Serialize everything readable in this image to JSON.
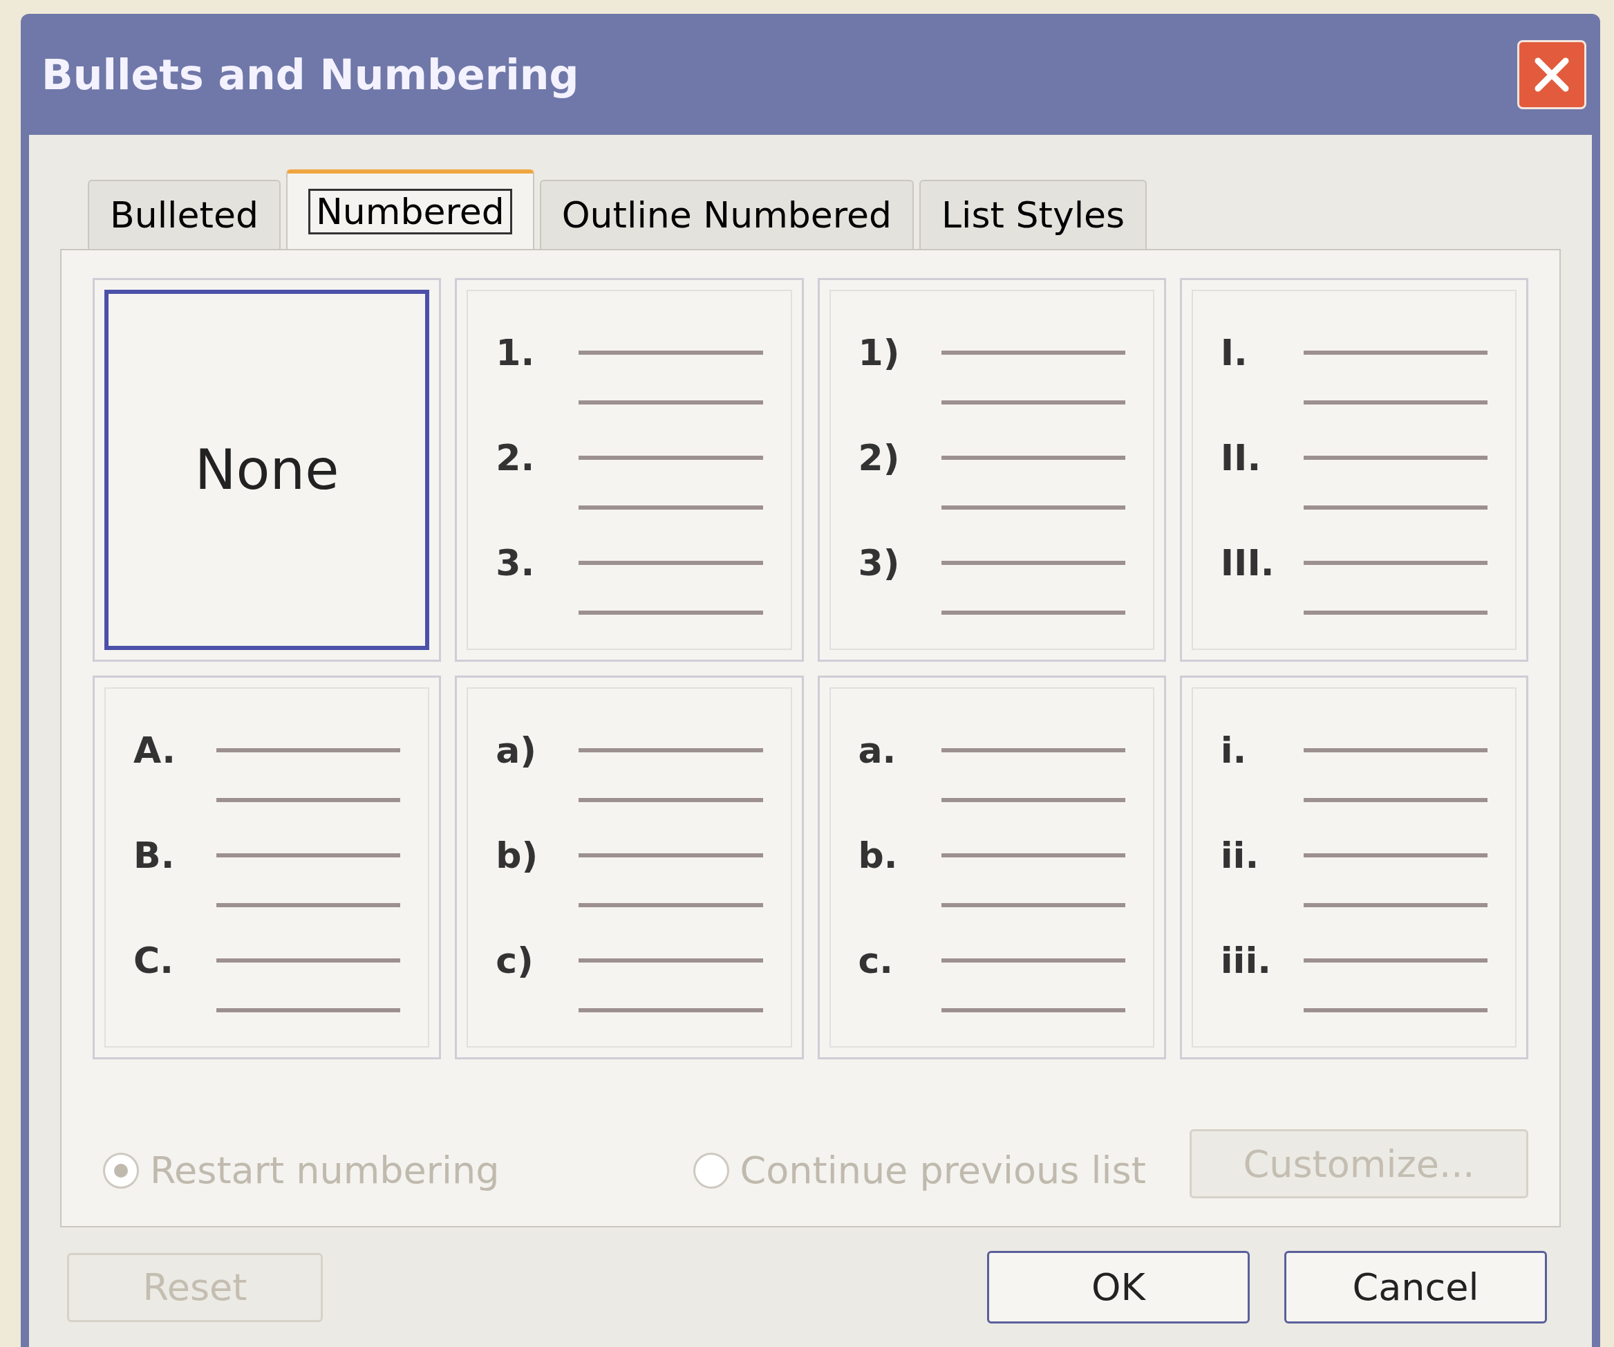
{
  "window": {
    "title": "Bullets and Numbering"
  },
  "tabs": [
    {
      "label": "Bulleted",
      "selected": false
    },
    {
      "label": "Numbered",
      "selected": true
    },
    {
      "label": "Outline Numbered",
      "selected": false
    },
    {
      "label": "List Styles",
      "selected": false
    }
  ],
  "styles": [
    {
      "kind": "none",
      "label": "None",
      "selected": true
    },
    {
      "kind": "list",
      "markers": [
        "1.",
        "2.",
        "3."
      ],
      "selected": false
    },
    {
      "kind": "list",
      "markers": [
        "1)",
        "2)",
        "3)"
      ],
      "selected": false
    },
    {
      "kind": "list",
      "markers": [
        "I.",
        "II.",
        "III."
      ],
      "selected": false
    },
    {
      "kind": "list",
      "markers": [
        "A.",
        "B.",
        "C."
      ],
      "selected": false
    },
    {
      "kind": "list",
      "markers": [
        "a)",
        "b)",
        "c)"
      ],
      "selected": false
    },
    {
      "kind": "list",
      "markers": [
        "a.",
        "b.",
        "c."
      ],
      "selected": false
    },
    {
      "kind": "list",
      "markers": [
        "i.",
        "ii.",
        "iii."
      ],
      "selected": false
    }
  ],
  "options": [
    {
      "label": "Restart numbering",
      "selected": true,
      "disabled": true
    },
    {
      "label": "Continue previous list",
      "selected": false,
      "disabled": true
    }
  ],
  "customize": {
    "label": "Customize...",
    "disabled": true
  },
  "buttons": [
    {
      "label": "Reset",
      "disabled": true
    },
    {
      "label": "OK",
      "disabled": false
    },
    {
      "label": "Cancel",
      "disabled": false
    }
  ]
}
